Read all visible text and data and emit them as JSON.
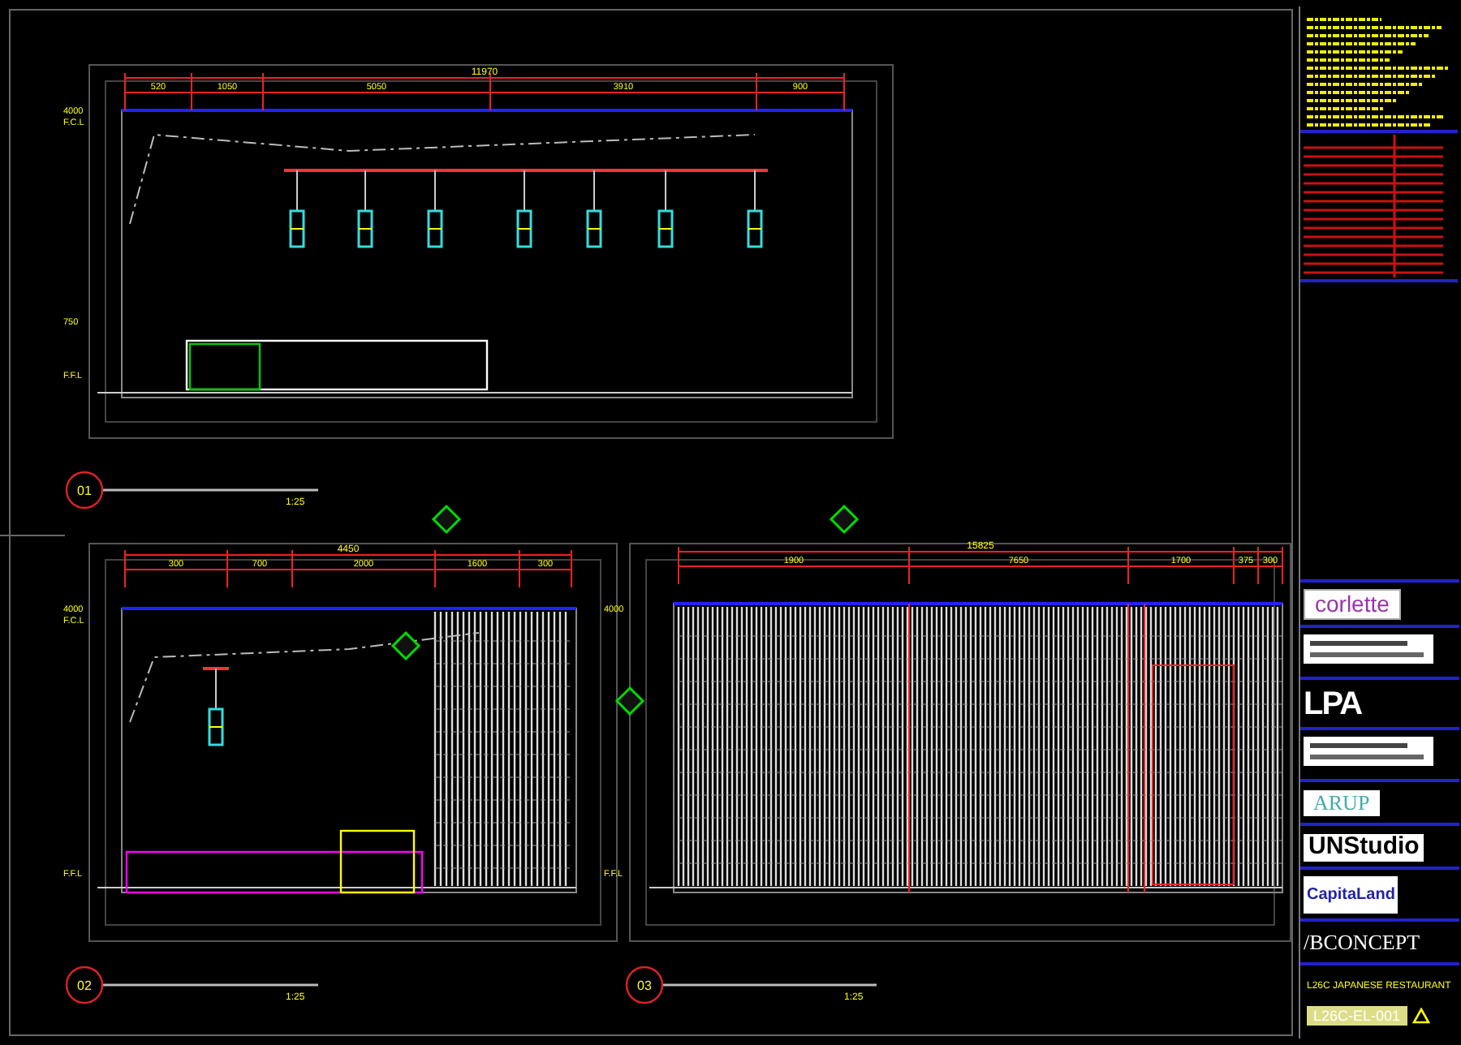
{
  "views": [
    {
      "number": "01",
      "scale": "1:25",
      "overall": "11970",
      "segments": [
        "520",
        "1050",
        "5050",
        "3910",
        "900"
      ],
      "levels": [
        "4000",
        "F.C.L",
        "750",
        "F.F.L"
      ]
    },
    {
      "number": "02",
      "scale": "1:25",
      "overall": "4450",
      "segments": [
        "300",
        "700",
        "2000",
        "1600",
        "300"
      ],
      "levels": [
        "4000",
        "F.C.L",
        "F.F.L"
      ]
    },
    {
      "number": "03",
      "scale": "1:25",
      "overall": "15825",
      "segments": [
        "1900",
        "7650",
        "1700",
        "375",
        "300"
      ],
      "levels": [
        "4000",
        "F.F.L"
      ]
    }
  ],
  "title_block": {
    "logos": [
      {
        "kind": "corlette",
        "text": "corlette"
      },
      {
        "kind": "graphic"
      },
      {
        "kind": "lpa",
        "text": "LPA"
      },
      {
        "kind": "graphic"
      },
      {
        "kind": "arup",
        "text": "ARUP"
      },
      {
        "kind": "unstudio",
        "text": "UNStudio"
      },
      {
        "kind": "capitaland",
        "text": "CapitaLand"
      },
      {
        "kind": "bconcept",
        "text": "/BCONCEPT"
      }
    ],
    "project": "L26C JAPANESE RESTAURANT",
    "drawing_number": "L26C-EL-001"
  }
}
